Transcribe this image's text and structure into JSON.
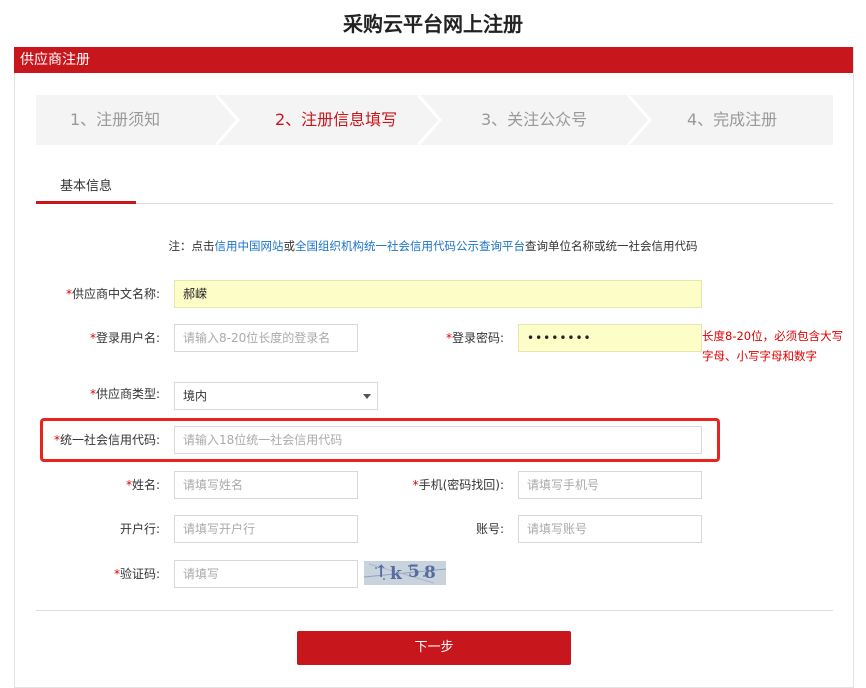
{
  "page_title": "采购云平台网上注册",
  "panel_title": "供应商注册",
  "steps": [
    {
      "label": "1、注册须知",
      "active": false
    },
    {
      "label": "2、注册信息填写",
      "active": true
    },
    {
      "label": "3、关注公众号",
      "active": false
    },
    {
      "label": "4、完成注册",
      "active": false
    }
  ],
  "tab": "基本信息",
  "notice": {
    "prefix": "注：点击",
    "link1": "信用中国网站",
    "or": "或",
    "link2": "全国组织机构统一社会信用代码公示查询平台",
    "suffix": "查询单位名称或统一社会信用代码"
  },
  "form": {
    "required_mark": "*",
    "supplier_name": {
      "label": "供应商中文名称:",
      "value": "郝嵘"
    },
    "username": {
      "label": "登录用户名:",
      "placeholder": "请输入8-20位长度的登录名"
    },
    "password": {
      "label": "登录密码:",
      "value": "••••••••"
    },
    "password_hint": "长度8-20位，必须包含大写字母、小写字母和数字",
    "supplier_type": {
      "label": "供应商类型:",
      "value": "境内"
    },
    "credit_code": {
      "label": "统一社会信用代码:",
      "placeholder": "请输入18位统一社会信用代码"
    },
    "name": {
      "label": "姓名:",
      "placeholder": "请填写姓名"
    },
    "phone": {
      "label": "手机(密码找回):",
      "placeholder": "请填写手机号"
    },
    "bank": {
      "label": "开户行:",
      "placeholder": "请填写开户行"
    },
    "account": {
      "label": "账号:",
      "placeholder": "请填写账号"
    },
    "captcha": {
      "label": "验证码:",
      "placeholder": "请填写",
      "chars": [
        "↑",
        "k",
        "5",
        "8"
      ]
    }
  },
  "next_button": "下一步",
  "colors": {
    "brand_red": "#c8161d",
    "highlight": "#e8241f",
    "link": "#1a73c8",
    "filled_bg": "#fdfdc8"
  }
}
